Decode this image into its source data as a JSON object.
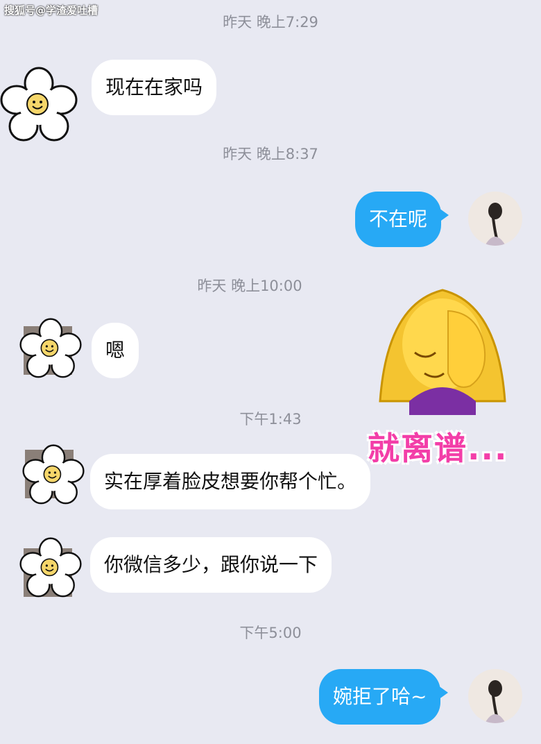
{
  "watermark": "搜狐号@学渣爱吐槽",
  "messages": [
    {
      "type": "time",
      "text": "昨天 晚上7:29"
    },
    {
      "type": "in",
      "text": "现在在家吗"
    },
    {
      "type": "time",
      "text": "昨天 晚上8:37"
    },
    {
      "type": "out",
      "text": "不在呢"
    },
    {
      "type": "time",
      "text": "昨天 晚上10:00"
    },
    {
      "type": "in",
      "text": "嗯"
    },
    {
      "type": "time",
      "text": "下午1:43"
    },
    {
      "type": "in",
      "text": "实在厚着脸皮想要你帮个忙。"
    },
    {
      "type": "in",
      "text": "你微信多少，跟你说一下"
    },
    {
      "type": "time",
      "text": "下午5:00"
    },
    {
      "type": "out",
      "text": "婉拒了哈~"
    }
  ],
  "sticker": {
    "text": "就离谱...",
    "icon": "facepalm-woman-emoji"
  },
  "colors": {
    "background": "#e8e9f2",
    "out_bubble": "#27a9f5",
    "in_bubble": "#ffffff",
    "sticker_text": "#f33ea8"
  }
}
